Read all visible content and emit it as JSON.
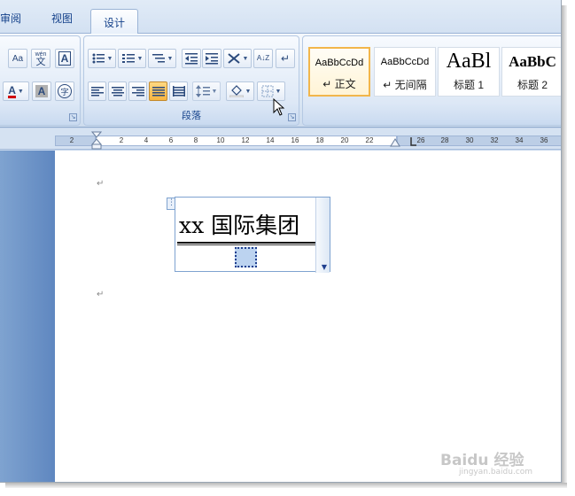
{
  "tabs": [
    "审阅",
    "视图",
    "设计"
  ],
  "active_tab": "设计",
  "ribbon": {
    "group_left_partial": {
      "buttons": [
        "change-case",
        "phonetic-guide",
        "character-border",
        "font-color",
        "character-shading",
        "enclose-characters"
      ],
      "glyphs": {
        "change_case": "Aa",
        "phonetic": "wén",
        "phonetic_big": "文",
        "border_a": "A",
        "color_a": "A",
        "shade_a": "A",
        "enclose": "字"
      }
    },
    "paragraph_group": {
      "label": "段落",
      "glyphs": {
        "sort": "A↓Z",
        "show_marks": "↵"
      }
    },
    "styles_group": {
      "items": [
        {
          "sample": "AaBbCcDd",
          "name": "↵ 正文",
          "selected": true
        },
        {
          "sample": "AaBbCcDd",
          "name": "↵ 无间隔",
          "selected": false
        },
        {
          "sample": "AaBl",
          "name": "标题 1",
          "selected": false
        },
        {
          "sample": "AaBbC",
          "name": "标题 2",
          "selected": false
        }
      ]
    }
  },
  "ruler": {
    "ticks": [
      "2",
      "2",
      "4",
      "6",
      "8",
      "10",
      "12",
      "14",
      "16",
      "18",
      "20",
      "22",
      "26",
      "28",
      "30",
      "32",
      "34",
      "36"
    ]
  },
  "document": {
    "paragraph_mark": "↵",
    "textbox_title": "xx 国际集团",
    "textbox_anchor": "⋮"
  },
  "watermark": {
    "text": "Baidu 经验",
    "sub": "jingyan.baidu.com"
  },
  "colors": {
    "ribbon_text": "#15428b",
    "active_button": "#f7b43f",
    "selection": "#bcd3f0",
    "font_color_red": "#d00000"
  }
}
